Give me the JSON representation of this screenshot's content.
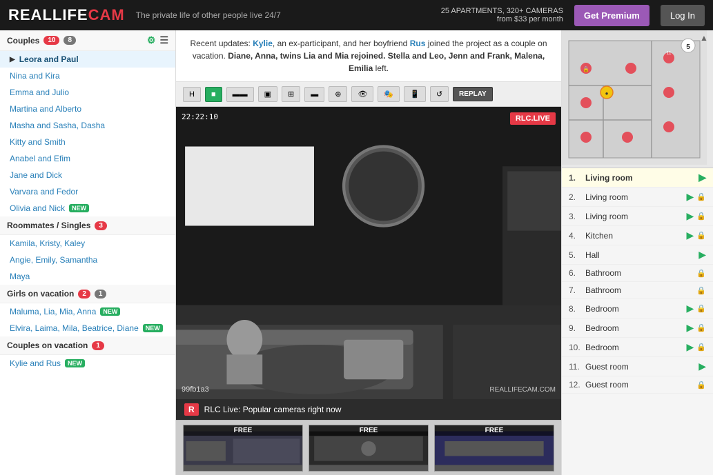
{
  "header": {
    "logo_real": "REAL",
    "logo_life": "LIFE",
    "logo_cam": "CAM",
    "tagline": "The private life of other people live 24/7",
    "stats_line1": "25 APARTMENTS, 320+ CAMERAS",
    "stats_line2": "from $33 per month",
    "btn_premium": "Get Premium",
    "btn_login": "Log In"
  },
  "announcement": {
    "prefix": "Recent updates: ",
    "name1": "Kylie",
    "text1": ", an ex-participant, and her boyfriend ",
    "name2": "Rus",
    "text2": " joined the project as a couple on vacation. ",
    "names3": "Diane, Anna, twins Lia and Mia rejoined.",
    "names4": " Stella and Leo, Jenn and Frank, Malena, Emilia",
    "text4": " left."
  },
  "sidebar": {
    "couples_label": "Couples",
    "couples_badge": "10",
    "couples_badge2": "8",
    "couples_items": [
      {
        "name": "Leora and Paul",
        "active": true,
        "arrow": true
      },
      {
        "name": "Nina and Kira"
      },
      {
        "name": "Emma and Julio"
      },
      {
        "name": "Martina and Alberto"
      },
      {
        "name": "Masha and Sasha, Dasha"
      },
      {
        "name": "Kitty and Smith"
      },
      {
        "name": "Anabel and Efim"
      },
      {
        "name": "Jane and Dick"
      },
      {
        "name": "Varvara and Fedor"
      },
      {
        "name": "Olivia and Nick",
        "new_badge": true
      }
    ],
    "roommates_label": "Roommates / Singles",
    "roommates_badge": "3",
    "roommates_items": [
      {
        "name": "Kamila, Kristy, Kaley"
      },
      {
        "name": "Angie, Emily, Samantha"
      },
      {
        "name": "Maya"
      }
    ],
    "girls_label": "Girls on vacation",
    "girls_badge": "2",
    "girls_badge2": "1",
    "girls_items": [
      {
        "name": "Maluma, Lia, Mia, Anna",
        "new_badge": true
      },
      {
        "name": "Elvira, Laima, Mila, Beatrice, Diane",
        "new_badge": true
      }
    ],
    "couples_vacation_label": "Couples on vacation",
    "couples_vacation_badge": "1",
    "couples_vacation_items": [
      {
        "name": "Kylie and Rus",
        "new_badge": true
      }
    ]
  },
  "video": {
    "timestamp": "22:22:10",
    "live_badge": "RLC.LIVE",
    "video_id": "99fb1a3",
    "watermark": "REALLIFECAM.COM",
    "toolbar_buttons": [
      "H",
      "■",
      "▬▬",
      "▣",
      "⊞",
      "▬",
      "⊕",
      "👁",
      "🎭",
      "📱",
      "↺",
      "REPLAY"
    ]
  },
  "rooms": [
    {
      "num": "1.",
      "name": "Living room",
      "active": true,
      "sound": true,
      "locked": false
    },
    {
      "num": "2.",
      "name": "Living room",
      "active": false,
      "sound": true,
      "locked": true
    },
    {
      "num": "3.",
      "name": "Living room",
      "active": false,
      "sound": true,
      "locked": true
    },
    {
      "num": "4.",
      "name": "Kitchen",
      "active": false,
      "sound": true,
      "locked": true
    },
    {
      "num": "5.",
      "name": "Hall",
      "active": false,
      "sound": true,
      "locked": false
    },
    {
      "num": "6.",
      "name": "Bathroom",
      "active": false,
      "sound": false,
      "locked": true
    },
    {
      "num": "7.",
      "name": "Bathroom",
      "active": false,
      "sound": false,
      "locked": true
    },
    {
      "num": "8.",
      "name": "Bedroom",
      "active": false,
      "sound": true,
      "locked": true
    },
    {
      "num": "9.",
      "name": "Bedroom",
      "active": false,
      "sound": true,
      "locked": true
    },
    {
      "num": "10.",
      "name": "Bedroom",
      "active": false,
      "sound": true,
      "locked": true
    },
    {
      "num": "11.",
      "name": "Guest room",
      "active": false,
      "sound": true,
      "locked": false
    },
    {
      "num": "12.",
      "name": "Guest room",
      "active": false,
      "sound": false,
      "locked": true
    }
  ],
  "bottom": {
    "section_icon": "R",
    "section_label": "RLC Live: Popular cameras right now",
    "thumbs": [
      {
        "label": "FREE"
      },
      {
        "label": "FREE"
      },
      {
        "label": "FREE"
      }
    ]
  }
}
